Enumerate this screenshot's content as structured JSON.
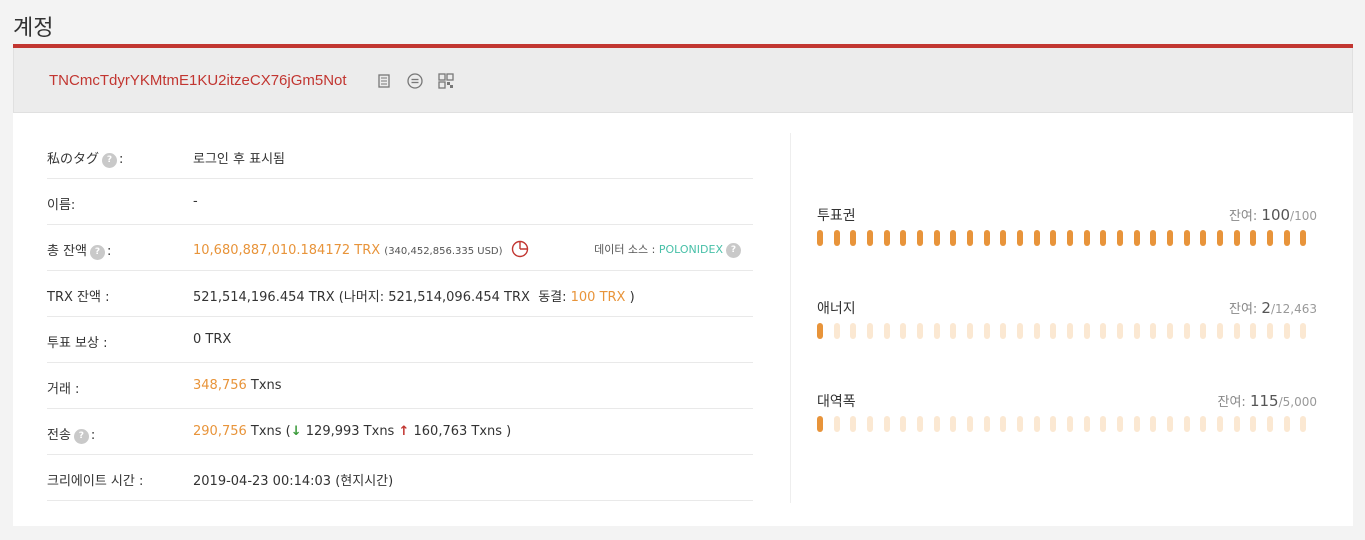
{
  "page": {
    "title": "계정"
  },
  "address": {
    "value": "TNCmcTdyrYKMtmE1KU2itzeCX76jGm5Not"
  },
  "rows": {
    "tag": {
      "label": "私のタグ",
      "colon": ":",
      "value": "로그인 후 표시됨"
    },
    "name": {
      "label": "이름:",
      "value": "-"
    },
    "total": {
      "label": "총 잔액",
      "colon": ":",
      "value": "10,680,887,010.184172 TRX",
      "usd": "(340,452,856.335 USD)",
      "source_label": "데이터 소스 : ",
      "source": "POLONIDEX"
    },
    "trx": {
      "label": "TRX 잔액 :",
      "value": "521,514,196.454 TRX (나머지: 521,514,096.454 TRX",
      "frozen_label": "동결: ",
      "frozen": "100 TRX",
      "close": " )"
    },
    "vote_reward": {
      "label": "투표 보상 :",
      "value": "0 TRX"
    },
    "txns": {
      "label": "거래 :",
      "count": "348,756",
      "unit": " Txns"
    },
    "transfers": {
      "label": "전송",
      "colon": ":",
      "count": "290,756",
      "unit": " Txns (",
      "in": " 129,993 Txns",
      "out": " 160,763 Txns )"
    },
    "created": {
      "label": "크리에이트 시간 :",
      "value": "2019-04-23 00:14:03 (현지시간)"
    }
  },
  "resources": [
    {
      "name": "투표권",
      "remaining_label": "잔여: ",
      "remaining": "100",
      "total": "/100",
      "fraction": 1.0
    },
    {
      "name": "애너지",
      "remaining_label": "잔여: ",
      "remaining": "2",
      "total": "/12,463",
      "fraction": 0.0002
    },
    {
      "name": "대역폭",
      "remaining_label": "잔여: ",
      "remaining": "115",
      "total": "/5,000",
      "fraction": 0.023
    }
  ],
  "colors": {
    "accent": "#c23631",
    "orange": "#e8943a",
    "teal": "#48c0a8",
    "dot_empty": "#fbe8d2"
  },
  "icons": [
    "copy-icon",
    "transfer-icon",
    "qrcode-icon",
    "question-icon",
    "pie-chart-icon",
    "arrow-down-icon",
    "arrow-up-icon"
  ]
}
